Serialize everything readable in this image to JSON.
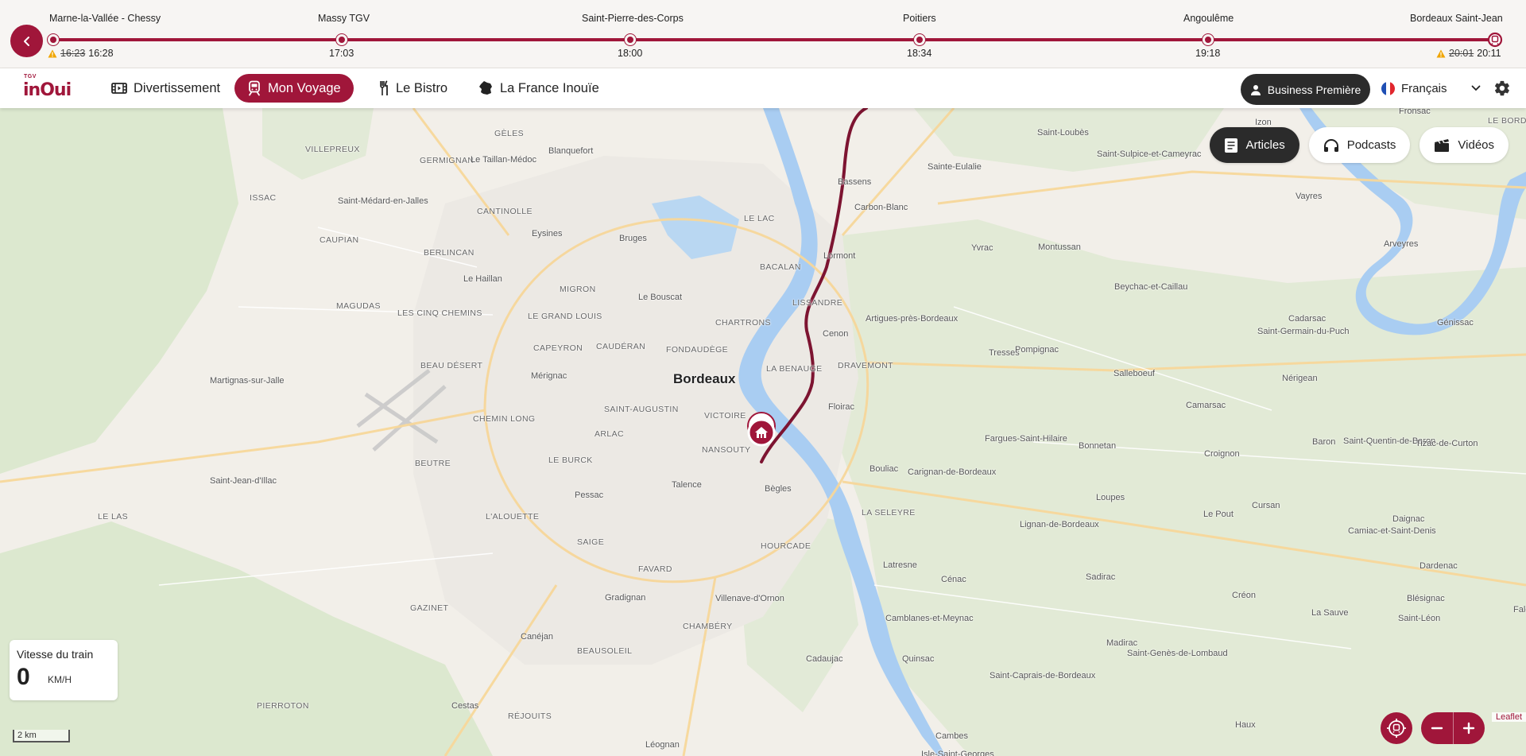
{
  "journey": {
    "stops": [
      {
        "name": "Marne-la-Vallée - Chessy",
        "scheduled": "16:23",
        "time": "16:28",
        "delayed": true
      },
      {
        "name": "Massy TGV",
        "scheduled": "",
        "time": "17:03",
        "delayed": false
      },
      {
        "name": "Saint-Pierre-des-Corps",
        "scheduled": "",
        "time": "18:00",
        "delayed": false
      },
      {
        "name": "Poitiers",
        "scheduled": "",
        "time": "18:34",
        "delayed": false
      },
      {
        "name": "Angoulême",
        "scheduled": "",
        "time": "19:18",
        "delayed": false
      },
      {
        "name": "Bordeaux Saint-Jean",
        "scheduled": "20:01",
        "time": "20:11",
        "delayed": true
      }
    ],
    "accent": "#a0163a"
  },
  "nav": {
    "logo_small": "TGV",
    "logo": "inOui",
    "items": [
      {
        "label": "Divertissement",
        "icon": "film-icon"
      },
      {
        "label": "Mon Voyage",
        "icon": "train-icon",
        "active": true
      },
      {
        "label": "Le Bistro",
        "icon": "cutlery-icon"
      },
      {
        "label": "La France Inouïe",
        "icon": "france-map-icon"
      }
    ],
    "class_label": "Business Première",
    "language": "Français"
  },
  "map": {
    "city": "Bordeaux",
    "places": [
      "GÈLES",
      "Blanquefort",
      "VILLEPREUX",
      "GERMIGNAN",
      "Le Taillan-Médoc",
      "ISSAC",
      "Saint-Médard-en-Jalles",
      "CANTINOLLE",
      "Eysines",
      "Bruges",
      "LE LAC",
      "CAUPIAN",
      "BERLINCAN",
      "Le Haillan",
      "MIGRON",
      "Le Bouscat",
      "MAGUDAS",
      "LES CINQ CHEMINS",
      "LE GRAND LOUIS",
      "CHARTRONS",
      "CAPEYRON",
      "CAUDÉRAN",
      "FONDAUDÈGE",
      "BEAU DÉSERT",
      "Mérignac",
      "Martignas-sur-Jalle",
      "SAINT-AUGUSTIN",
      "VICTOIRE",
      "CHEMIN LONG",
      "ARLAC",
      "NANSOUTY",
      "BEUTRE",
      "LE BURCK",
      "Talence",
      "Saint-Jean-d'Illac",
      "Bègles",
      "Pessac",
      "LE LAS",
      "L'ALOUETTE",
      "HOURCADE",
      "SAIGE",
      "FAVARD",
      "Gradignan",
      "Villenave-d'Ornon",
      "GAZINET",
      "CHAMBÉRY",
      "Canéjan",
      "BEAUSOLEIL",
      "Cadaujac",
      "PIERROTON",
      "Cestas",
      "RÉJOUITS",
      "Léognan",
      "Bassens",
      "Carbon-Blanc",
      "Lormont",
      "BACALAN",
      "LISSANDRE",
      "Cenon",
      "LA BENAUGE",
      "DRAVEMONT",
      "Floirac",
      "Bouliac",
      "LA SELEYRE",
      "Latresne",
      "Quinsac",
      "Cambes",
      "Isle-Saint-Georges",
      "Saint-Loubès",
      "Sainte-Eulalie",
      "Saint-Sulpice-et-Cameyrac",
      "Izon",
      "Fronsac",
      "LE BORD",
      "Vayres",
      "Yvrac",
      "Montussan",
      "Beychac-et-Caillau",
      "Arveyres",
      "Artigues-près-Bordeaux",
      "Tresses",
      "Pompignac",
      "Salleboeuf",
      "Cadarsac",
      "Génissac",
      "Saint-Germain-du-Puch",
      "Nérigean",
      "Camarsac",
      "Fargues-Saint-Hilaire",
      "Bonnetan",
      "Croignon",
      "Baron",
      "Saint-Quentin-de-Baron",
      "Tizac-de-Curton",
      "Carignan-de-Bordeaux",
      "Lignan-de-Bordeaux",
      "Loupes",
      "Le Pout",
      "Cursan",
      "Daignac",
      "Camiac-et-Saint-Denis",
      "Dardenac",
      "Cénac",
      "Sadirac",
      "Créon",
      "La Sauve",
      "Blésignac",
      "Saint-Léon",
      "Faleyras",
      "Camblanes-et-Meynac",
      "Madirac",
      "Saint-Genès-de-Lombaud",
      "Saint-Caprais-de-Bordeaux",
      "Haux",
      "LE LAS"
    ],
    "tabs": [
      {
        "label": "Articles",
        "icon": "article-icon",
        "active": true
      },
      {
        "label": "Podcasts",
        "icon": "headphones-icon"
      },
      {
        "label": "Vidéos",
        "icon": "clapperboard-icon"
      }
    ],
    "speed": {
      "title": "Vitesse du train",
      "value": "0",
      "unit": "KM/H"
    },
    "scale": "2 km",
    "attribution": "Leaflet"
  }
}
